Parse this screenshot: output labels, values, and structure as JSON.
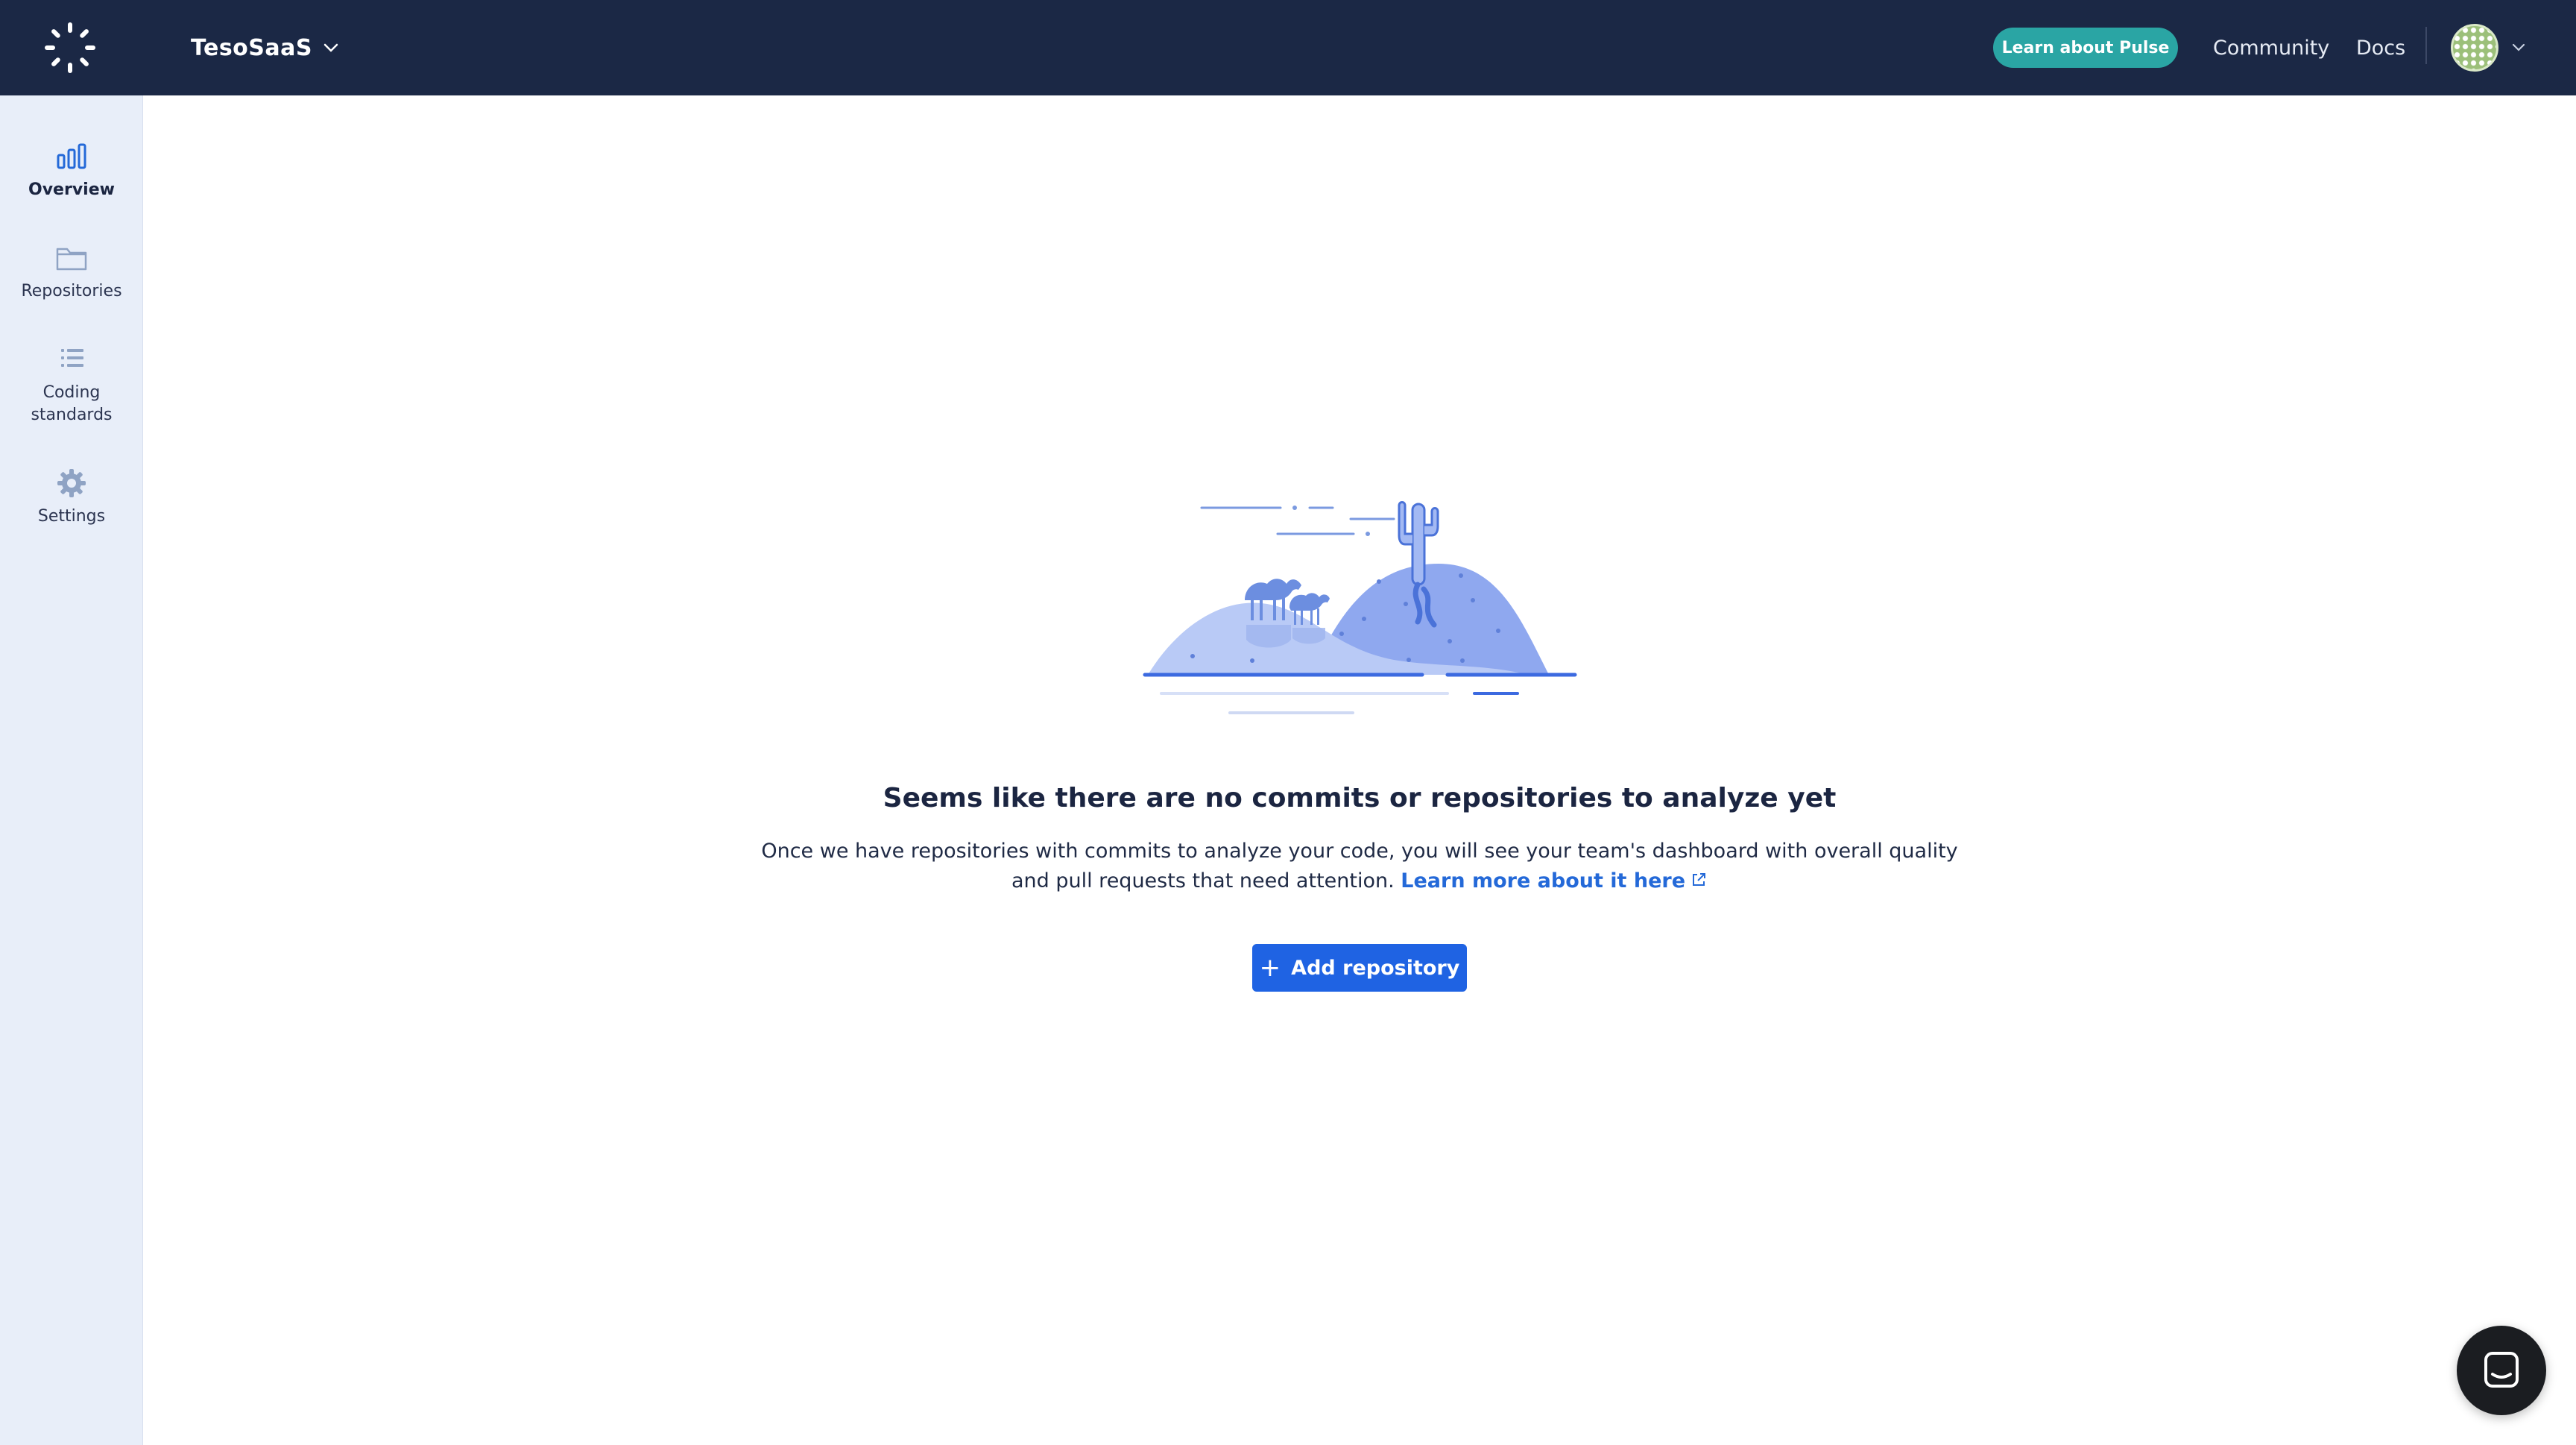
{
  "topbar": {
    "org_name": "TesoSaaS",
    "pulse_button": "Learn about Pulse",
    "community": "Community",
    "docs": "Docs"
  },
  "sidebar": {
    "items": [
      {
        "label": "Overview",
        "icon": "bar-chart-icon",
        "active": true
      },
      {
        "label": "Repositories",
        "icon": "folder-icon",
        "active": false
      },
      {
        "label": "Coding standards",
        "icon": "list-icon",
        "active": false
      },
      {
        "label": "Settings",
        "icon": "gear-icon",
        "active": false
      }
    ]
  },
  "empty_state": {
    "title": "Seems like there are no commits or repositories to analyze yet",
    "description": "Once we have repositories with commits to analyze your code, you will see your team's dashboard with overall quality and pull requests that need attention.",
    "link_text": "Learn more about it here",
    "button_label": "Add repository"
  },
  "colors": {
    "topbar": "#1b2845",
    "sidebar": "#e8eef9",
    "accent_blue": "#1f63e3",
    "pulse_teal": "#2aa5a4",
    "link": "#2469d8"
  }
}
